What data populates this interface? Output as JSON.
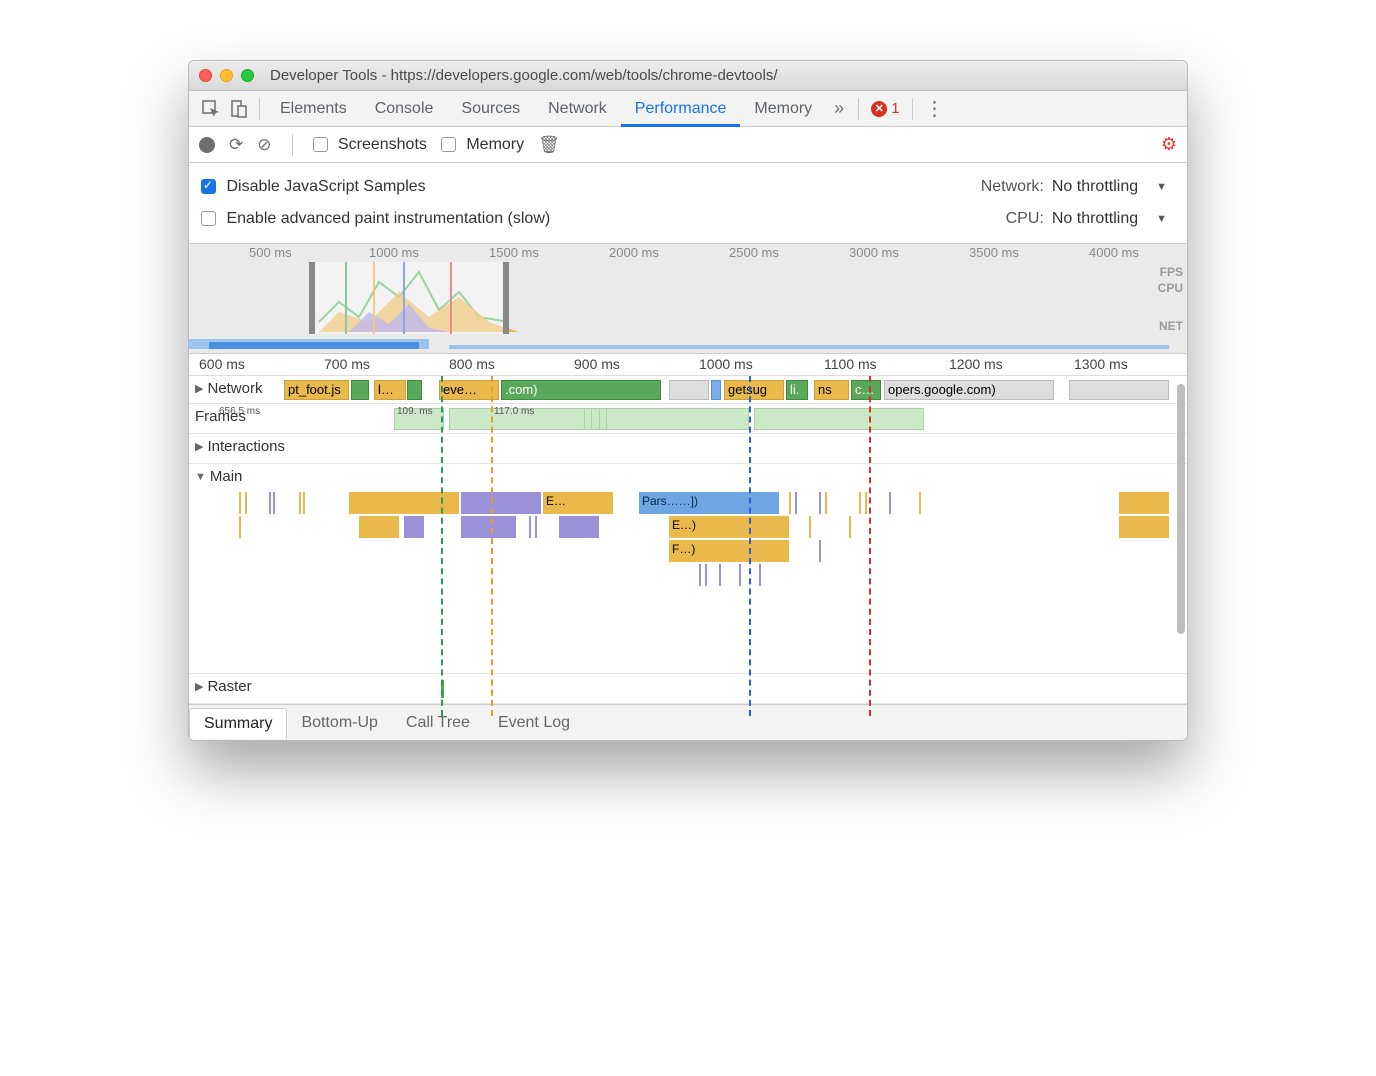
{
  "window": {
    "title": "Developer Tools - https://developers.google.com/web/tools/chrome-devtools/"
  },
  "tabs": {
    "items": [
      "Elements",
      "Console",
      "Sources",
      "Network",
      "Performance",
      "Memory"
    ],
    "active": "Performance",
    "more": "»",
    "errors": "1"
  },
  "perf_toolbar": {
    "screenshots": "Screenshots",
    "memory": "Memory"
  },
  "settings": {
    "disable_js": "Disable JavaScript Samples",
    "advanced_paint": "Enable advanced paint instrumentation (slow)",
    "network_label": "Network:",
    "network_value": "No throttling",
    "cpu_label": "CPU:",
    "cpu_value": "No throttling"
  },
  "overview": {
    "ticks": [
      "500 ms",
      "1000 ms",
      "1500 ms",
      "2000 ms",
      "2500 ms",
      "3000 ms",
      "3500 ms",
      "4000 ms"
    ],
    "labels": {
      "fps": "FPS",
      "cpu": "CPU",
      "net": "NET"
    }
  },
  "zoom_ruler": [
    "600 ms",
    "700 ms",
    "800 ms",
    "900 ms",
    "1000 ms",
    "1100 ms",
    "1200 ms",
    "1300 ms"
  ],
  "tracks": {
    "network": "Network",
    "frames": "Frames",
    "interactions": "Interactions",
    "main": "Main",
    "raster": "Raster"
  },
  "net_items": {
    "a": "pt_foot.js",
    "b": "l…",
    "c": "eve…",
    "d": ".com)",
    "e": "getsug",
    "f": "li.",
    "g": "ns",
    "h": "c…",
    "i": "opers.google.com)"
  },
  "frame_times": {
    "t0": "656.5 ms",
    "t1": "109. ms",
    "t2": "117.0 ms"
  },
  "flame": {
    "e1": "E…",
    "parse": "Pars……])",
    "e2": "E…)",
    "f1": "F…)"
  },
  "bottom_tabs": [
    "Summary",
    "Bottom-Up",
    "Call Tree",
    "Event Log"
  ]
}
